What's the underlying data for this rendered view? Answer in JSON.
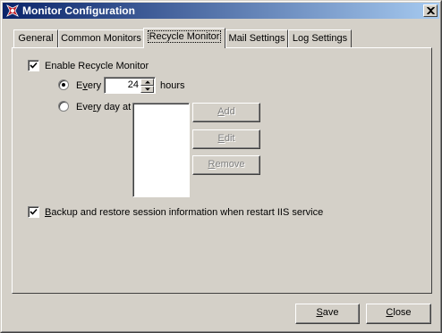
{
  "window": {
    "title": "Monitor Configuration",
    "icon": "app-logo-icon",
    "close_icon": "close-icon"
  },
  "tabs": [
    {
      "label": "General",
      "active": false
    },
    {
      "label": "Common Monitors",
      "active": false
    },
    {
      "label": "Recycle Monitor",
      "active": true
    },
    {
      "label": "Mail Settings",
      "active": false
    },
    {
      "label": "Log Settings",
      "active": false
    }
  ],
  "recycle": {
    "enable_label": "Enable Recycle Monitor",
    "enable_checked": true,
    "every_label_pre": "E",
    "every_label_ul": "v",
    "every_label_post": "ery",
    "every_checked": true,
    "hours_value": "24",
    "hours_label": "hours",
    "everyday_label_pre": "Eve",
    "everyday_label_ul": "r",
    "everyday_label_post": "y day at",
    "everyday_checked": false,
    "times_list": [],
    "add_ul": "A",
    "add_rest": "dd",
    "edit_ul": "E",
    "edit_rest": "dit",
    "remove_ul": "R",
    "remove_rest": "emove",
    "backup_ul": "B",
    "backup_rest": "ackup and restore session information when restart IIS service",
    "backup_checked": true
  },
  "footer": {
    "save_ul": "S",
    "save_rest": "ave",
    "close_ul": "C",
    "close_rest": "lose"
  },
  "colors": {
    "titlebar_start": "#0a246a",
    "titlebar_end": "#a6caf0",
    "face": "#d4d0c8"
  }
}
